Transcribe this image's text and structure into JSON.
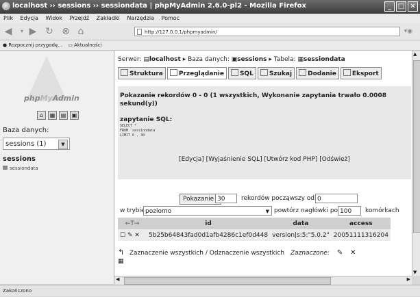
{
  "window": {
    "title": "localhost ›› sessions ›› sessiondata | phpMyAdmin 2.6.0-pl2 - Mozilla Firefox"
  },
  "menu": [
    "Plik",
    "Edycja",
    "Widok",
    "Przejdź",
    "Zakładki",
    "Narzędzia",
    "Pomoc"
  ],
  "nav": {
    "url": "http://127.0.0.1/phpmyadmin/"
  },
  "bookmarks": [
    "Rozpocznij przygodę...",
    "Aktualności"
  ],
  "sidebar": {
    "logo_php": "php",
    "logo_my": "My",
    "logo_admin": "Admin",
    "db_label": "Baza danych:",
    "db_selected": "sessions (1)",
    "db_name": "sessions",
    "table_link": "sessiondata"
  },
  "breadcrumb": {
    "server_label": "Serwer:",
    "server": "localhost",
    "db_label": "Baza danych:",
    "db": "sessions",
    "table_label": "Tabela:",
    "table": "sessiondata"
  },
  "tabs": [
    "Struktura",
    "Przeglądanie",
    "SQL",
    "Szukaj",
    "Dodanie",
    "Eksport"
  ],
  "notice": {
    "message": "Pokazanie rekordów 0 - 0 (1 wszystkich, Wykonanie zapytania trwało 0.0008 sekund(y))",
    "sql_label": "zapytanie SQL:",
    "sql_lines": [
      "SELECT *",
      "FROM `sessiondata`",
      "LIMIT 0 , 30"
    ],
    "links": "[Edycja] [Wyjaśnienie SQL] [Utwórz kod PHP] [Odśwież]"
  },
  "navform": {
    "show_button": "Pokazanie :",
    "count": "30",
    "records_from": "rekordów począwszy od",
    "start": "0",
    "mode_label": "w trybie",
    "mode": "poziomo",
    "repeat_label": "powtórz nagłówki po",
    "repeat": "100",
    "cells_label": "komórkach"
  },
  "results": {
    "columns": [
      "←T→",
      "id",
      "data",
      "access"
    ],
    "rows": [
      {
        "id": "5b25b64843fad0d1afb4286c1ef0d448",
        "data": "version|s:5:\"5.0.2\"",
        "access": "20051111316204"
      }
    ]
  },
  "selection": {
    "select_all": "Zaznaczenie wszystkich",
    "separator": "/",
    "deselect_all": "Odznaczenie wszystkich",
    "selected": "Zaznaczone:"
  },
  "status": {
    "text": "Zakończono"
  }
}
